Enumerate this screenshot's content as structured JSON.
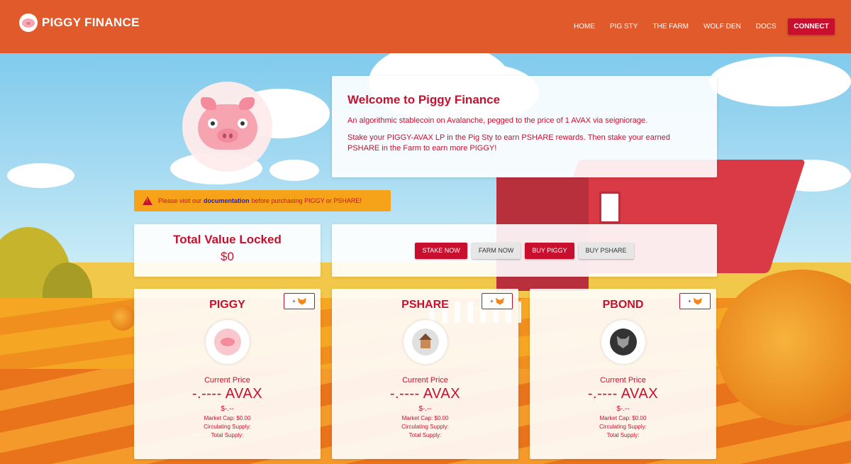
{
  "header": {
    "logo_text": "PIGGY FINANCE",
    "nav": [
      "HOME",
      "PIG STY",
      "THE FARM",
      "WOLF DEN",
      "DOCS"
    ],
    "connect_label": "CONNECT"
  },
  "welcome": {
    "title": "Welcome to Piggy Finance",
    "line1": "An algorithmic stablecoin on Avalanche, pegged to the price of 1 AVAX via seigniorage.",
    "line2": "Stake your PIGGY-AVAX LP in the Pig Sty to earn PSHARE rewards. Then stake your earned PSHARE in the Farm to earn more PIGGY!"
  },
  "warning": {
    "prefix": "Please visit our",
    "link": "documentation",
    "suffix": "before purchasing PIGGY or PSHARE!"
  },
  "tvl": {
    "title": "Total Value Locked",
    "value": "$0"
  },
  "actions": {
    "stake_now": "STAKE NOW",
    "farm_now": "FARM NOW",
    "buy_piggy": "BUY PIGGY",
    "buy_pshare": "BUY PSHARE"
  },
  "tokens": [
    {
      "name": "PIGGY",
      "add_label": "+",
      "current_price_label": "Current Price",
      "price": "-.---- AVAX",
      "usd": "$-.--",
      "market_cap": "Market Cap: $0.00",
      "circulating": "Circulating Supply:",
      "total": "Total Supply:",
      "icon": "pig-icon"
    },
    {
      "name": "PSHARE",
      "add_label": "+",
      "current_price_label": "Current Price",
      "price": "-.---- AVAX",
      "usd": "$-.--",
      "market_cap": "Market Cap: $0.00",
      "circulating": "Circulating Supply:",
      "total": "Total Supply:",
      "icon": "house-icon"
    },
    {
      "name": "PBOND",
      "add_label": "+",
      "current_price_label": "Current Price",
      "price": "-.---- AVAX",
      "usd": "$-.--",
      "market_cap": "Market Cap: $0.00",
      "circulating": "Circulating Supply:",
      "total": "Total Supply:",
      "icon": "wolf-icon"
    }
  ],
  "colors": {
    "header_bg": "#e05a2b",
    "accent": "#c8102e",
    "warning_bg": "#f7a31a",
    "link": "#1a1ad6"
  }
}
